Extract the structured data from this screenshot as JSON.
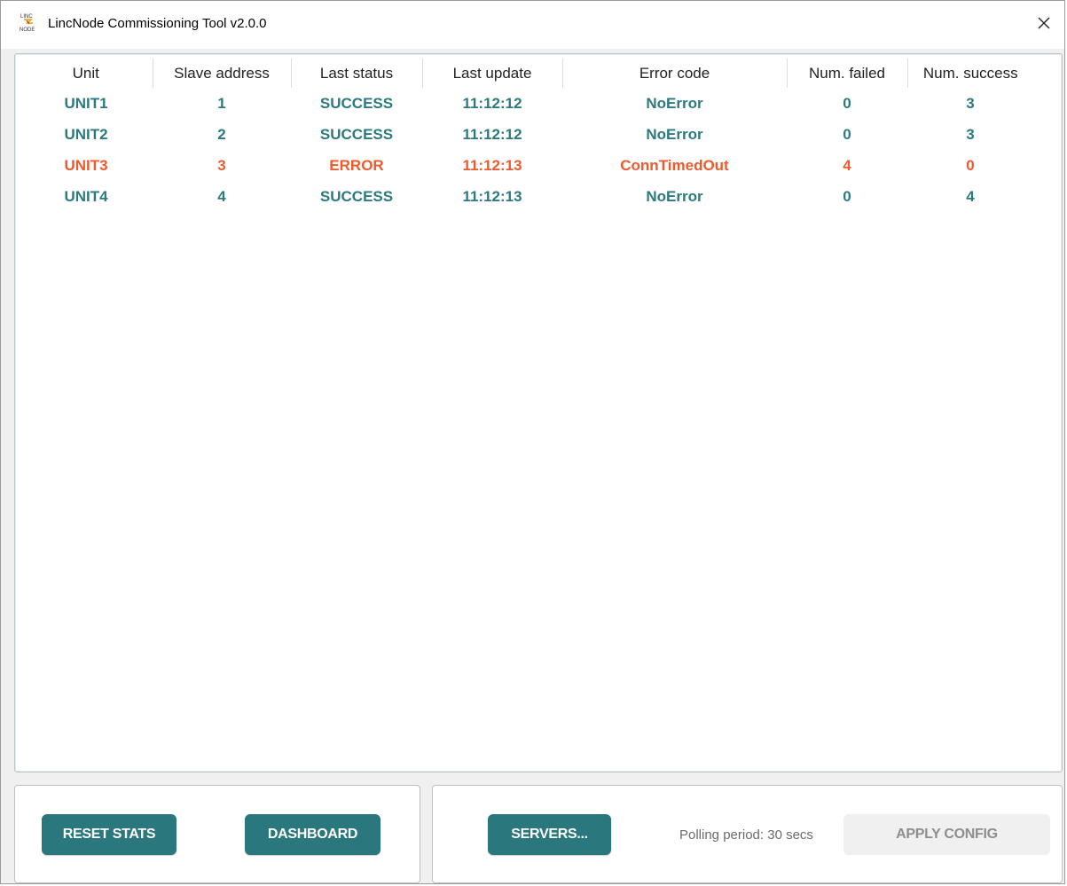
{
  "window": {
    "title": "LincNode Commissioning Tool v2.0.0",
    "close_glyph": "✕"
  },
  "table": {
    "columns": [
      "Unit",
      "Slave address",
      "Last status",
      "Last update",
      "Error code",
      "Num. failed",
      "Num. success"
    ],
    "rows": [
      {
        "unit": "UNIT1",
        "slave_address": "1",
        "last_status": "SUCCESS",
        "last_update": "11:12:12",
        "error_code": "NoError",
        "num_failed": "0",
        "num_success": "3",
        "state": "ok"
      },
      {
        "unit": "UNIT2",
        "slave_address": "2",
        "last_status": "SUCCESS",
        "last_update": "11:12:12",
        "error_code": "NoError",
        "num_failed": "0",
        "num_success": "3",
        "state": "ok"
      },
      {
        "unit": "UNIT3",
        "slave_address": "3",
        "last_status": "ERROR",
        "last_update": "11:12:13",
        "error_code": "ConnTimedOut",
        "num_failed": "4",
        "num_success": "0",
        "state": "error"
      },
      {
        "unit": "UNIT4",
        "slave_address": "4",
        "last_status": "SUCCESS",
        "last_update": "11:12:13",
        "error_code": "NoError",
        "num_failed": "0",
        "num_success": "4",
        "state": "ok"
      }
    ]
  },
  "buttons": {
    "reset_stats": "RESET STATS",
    "dashboard": "DASHBOARD",
    "servers": "SERVERS...",
    "apply_config": "APPLY CONFIG"
  },
  "polling_text": "Polling period: 30 secs",
  "colors": {
    "accent": "#2a777d",
    "ok_text": "#2b7a7f",
    "error_text": "#ee5a2e"
  },
  "icons": {
    "app": "lincnode-logo-icon",
    "close": "close-icon"
  }
}
